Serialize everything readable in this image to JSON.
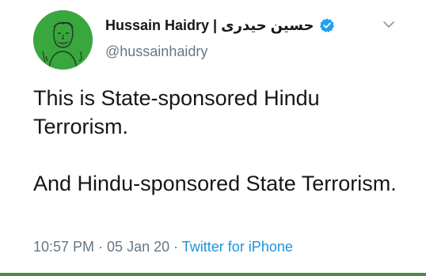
{
  "author": {
    "display_name": "Hussain Haidry | حسین حیدری",
    "handle": "@hussainhaidry",
    "verified_icon": "verified-badge-icon",
    "avatar_color": "#3aa63e"
  },
  "tweet": {
    "paragraphs": [
      "This is State-sponsored Hindu Terrorism.",
      "And Hindu-sponsored State Terrorism."
    ]
  },
  "meta": {
    "time": "10:57 PM",
    "separator_1": " · ",
    "date": "05 Jan 20",
    "separator_2": " · ",
    "source": "Twitter for iPhone"
  },
  "colors": {
    "text": "#14171a",
    "secondary": "#657786",
    "link": "#1b95e0",
    "verified": "#1da1f2"
  },
  "menu_icon": "chevron-down-icon"
}
